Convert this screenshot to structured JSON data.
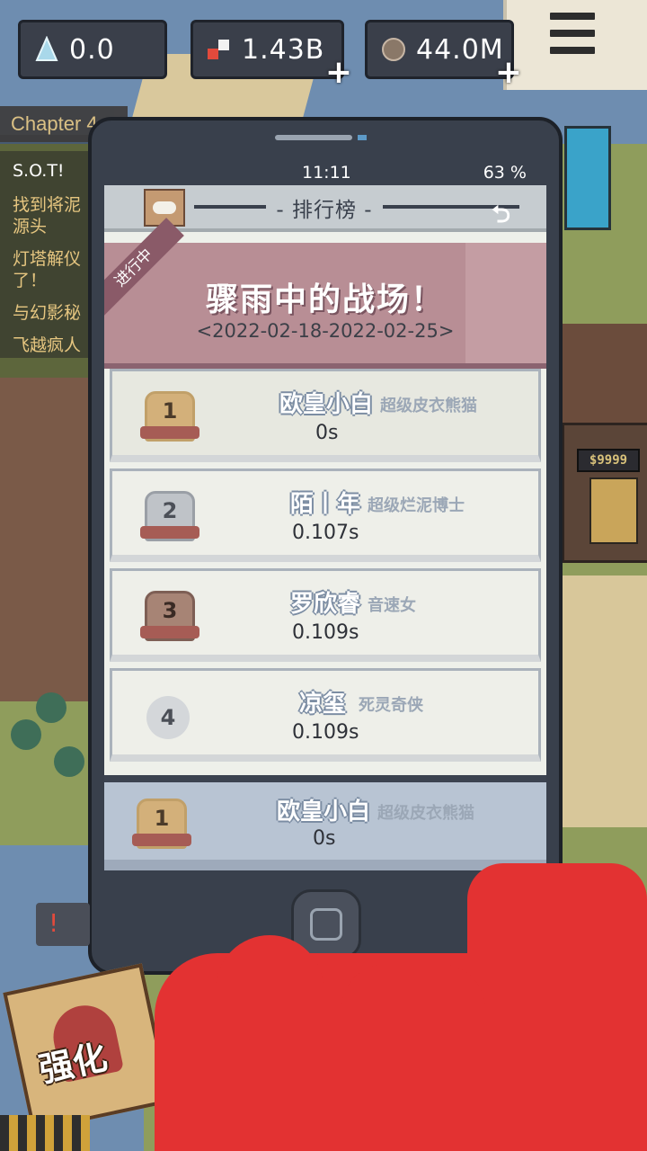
{
  "hud": {
    "gem_value": "0.0",
    "money_value": "1.43B",
    "ore_value": "44.0M",
    "plus_label": "+"
  },
  "quests": {
    "chapter": "Chapter 4",
    "lines": [
      "S.O.T!",
      "找到将泥",
      "源头",
      "灯塔解仪",
      "了！",
      "与幻影秘",
      "飞越疯人"
    ]
  },
  "phone": {
    "time": "11:11",
    "battery": "63 %",
    "title": "- 排行榜 -",
    "banner": {
      "status": "进行中",
      "event_title": "骤雨中的战场！",
      "dates": "<2022-02-18-2022-02-25>"
    },
    "leaderboard": [
      {
        "rank": "1",
        "name": "欧皇小白",
        "title": "超级皮衣熊猫",
        "time": "0s"
      },
      {
        "rank": "2",
        "name": "陌丨年",
        "title": "超级烂泥博士",
        "time": "0.107s"
      },
      {
        "rank": "3",
        "name": "罗欣睿",
        "title": "音速女",
        "time": "0.109s"
      },
      {
        "rank": "4",
        "name": "凉玺",
        "title": "死灵奇侠",
        "time": "0.109s"
      }
    ],
    "my_rank": {
      "rank": "1",
      "name": "欧皇小白",
      "title": "超级皮衣熊猫",
      "time": "0s"
    }
  },
  "bottom": {
    "upgrade_label": "强化",
    "warning_icon": "!",
    "sign_value": "$9999"
  }
}
